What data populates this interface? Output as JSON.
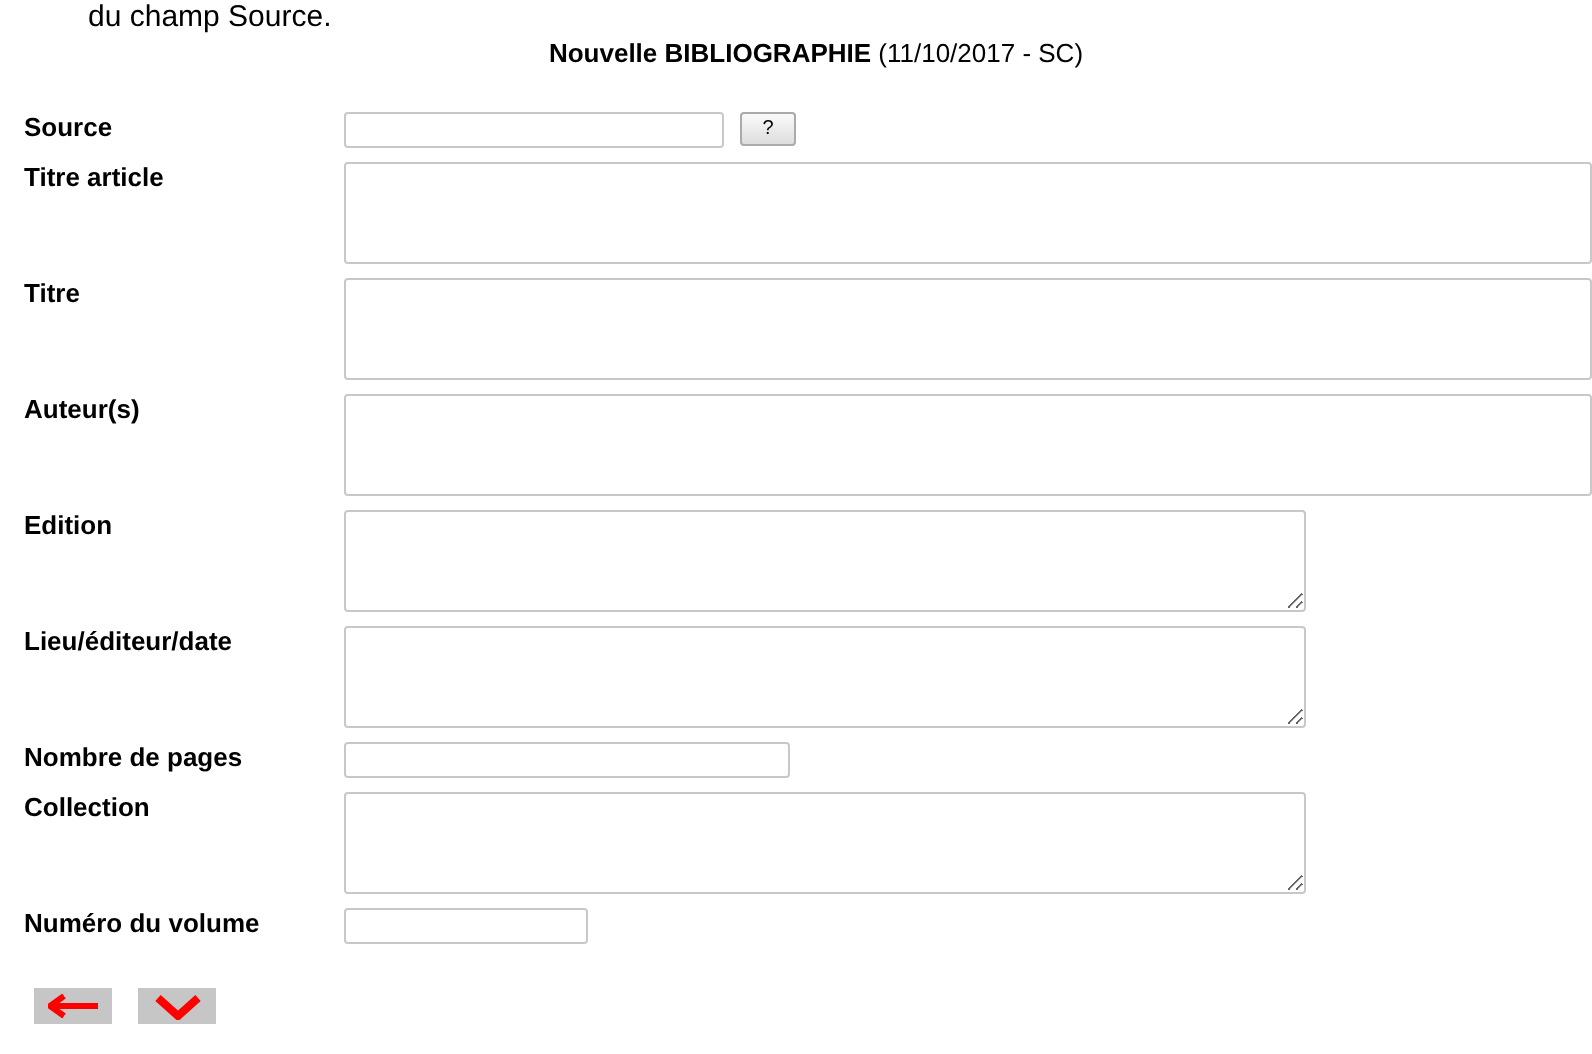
{
  "intro_text": "du champ Source.",
  "title": "**Nouvelle BIBLIOGRAPHIE** (11/10/2017 - SC)",
  "fields": [
    {
      "label": "Source",
      "kind": "input",
      "help_button": "?"
    },
    {
      "label": "Titre article",
      "kind": "wide-textarea"
    },
    {
      "label": "Titre",
      "kind": "wide-textarea"
    },
    {
      "label": "Auteur(s)",
      "kind": "wide-textarea"
    },
    {
      "label": "Edition",
      "kind": "textarea"
    },
    {
      "label": "Lieu/éditeur/date",
      "kind": "textarea"
    },
    {
      "label": "Nombre de pages",
      "kind": "input"
    },
    {
      "label": "Collection",
      "kind": "textarea"
    },
    {
      "label": "Numéro du volume",
      "kind": "input"
    }
  ],
  "buttons": [
    {
      "kind": "back"
    },
    {
      "kind": "confirm"
    }
  ]
}
